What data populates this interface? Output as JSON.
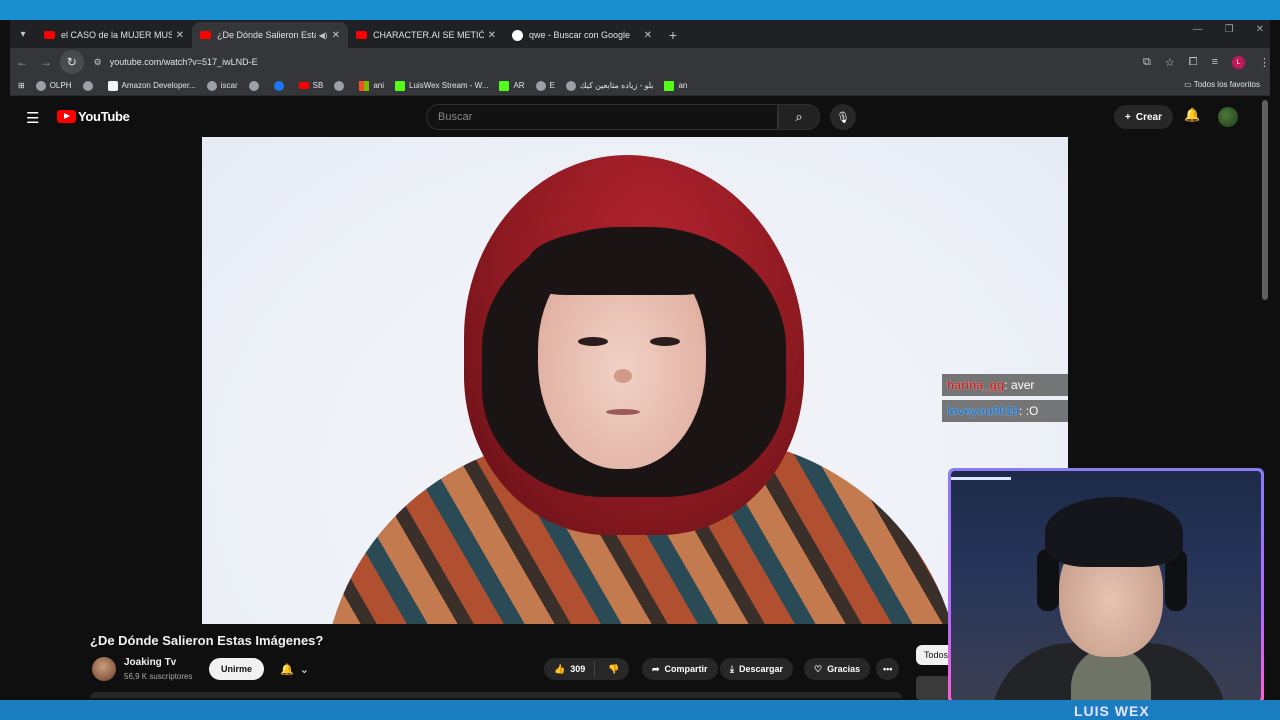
{
  "browser": {
    "tabs": [
      {
        "title": "el CASO de la MUJER MUSULM",
        "favicon": "youtube-icon",
        "active": false
      },
      {
        "title": "¿De Dónde Salieron Estas Im",
        "favicon": "youtube-icon",
        "active": true,
        "audio": true
      },
      {
        "title": "CHARACTER.AI SE METIÓ EN S",
        "favicon": "youtube-icon",
        "active": false
      },
      {
        "title": "qwe - Buscar con Google",
        "favicon": "google-icon",
        "active": false
      }
    ],
    "url": "youtube.com/watch?v=517_iwLND-E",
    "profile_initial": "L",
    "bookmarks": [
      {
        "label": "OLPH",
        "icon": "google-icon"
      },
      {
        "label": "",
        "icon": "globe-icon"
      },
      {
        "label": "Amazon Developer...",
        "icon": "amazon-icon"
      },
      {
        "label": "iscar",
        "icon": "globe-icon"
      },
      {
        "label": "",
        "icon": "globe-icon"
      },
      {
        "label": "",
        "icon": "facebook-icon"
      },
      {
        "label": "SB",
        "icon": "youtube-icon"
      },
      {
        "label": "",
        "icon": "globe-icon"
      },
      {
        "label": "ani",
        "icon": "microsoft-icon"
      },
      {
        "label": "LuisWex Stream - W...",
        "icon": "kick-icon"
      },
      {
        "label": "AR",
        "icon": "kick-icon"
      },
      {
        "label": "E",
        "icon": "globe-icon"
      },
      {
        "label": "بلو - زياده متابعين كيك",
        "icon": "globe-icon"
      },
      {
        "label": "an",
        "icon": "kick-icon"
      }
    ],
    "all_bookmarks": "Todos los favoritos"
  },
  "youtube": {
    "logo_text": "YouTube",
    "search_placeholder": "Buscar",
    "create_label": "Crear",
    "video_title": "¿De Dónde Salieron Estas Imágenes?",
    "channel_name": "Joaking Tv",
    "subscribers": "56,9 K suscriptores",
    "join_label": "Unirme",
    "likes": "309",
    "share_label": "Compartir",
    "download_label": "Descargar",
    "thanks_label": "Gracias",
    "filter_chip": "Todos"
  },
  "chat": [
    {
      "user": "harina_gg",
      "message": " : aver"
    },
    {
      "user": "loveyou0010",
      "message": " : :O"
    }
  ],
  "overlay_brand": "LUIS WEX",
  "colors": {
    "youtube_red": "#ff0000",
    "accent_frame": "#1a8fd0",
    "cam_border": "#b569ff"
  }
}
